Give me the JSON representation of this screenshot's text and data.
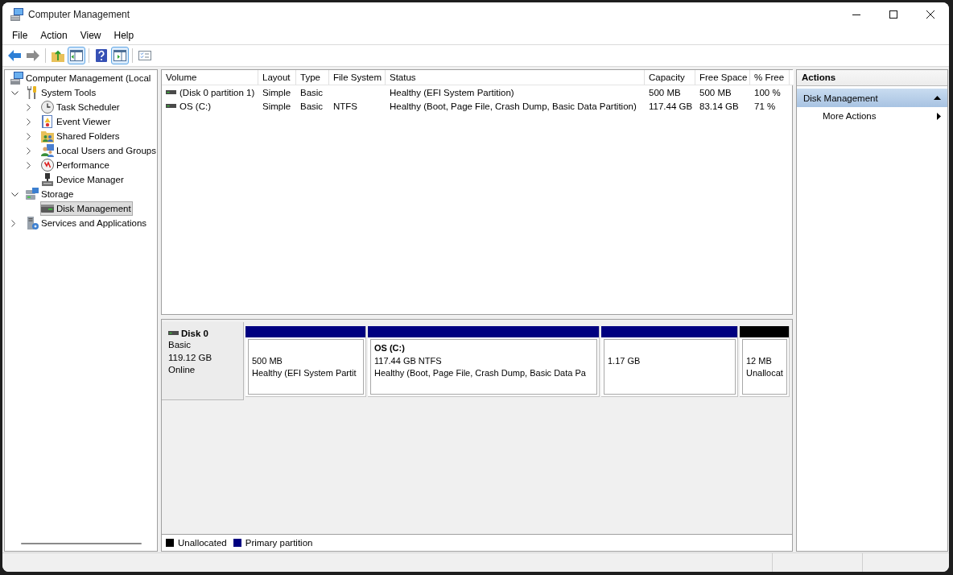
{
  "window": {
    "title": "Computer Management"
  },
  "menu": [
    "File",
    "Action",
    "View",
    "Help"
  ],
  "toolbar": {
    "groups": [
      [
        {
          "pressed": false
        },
        {
          "pressed": false
        }
      ],
      [
        {
          "pressed": false
        },
        {
          "pressed": true
        }
      ],
      [
        {
          "pressed": false
        },
        {
          "pressed": true
        }
      ],
      [
        {
          "pressed": false
        }
      ]
    ]
  },
  "tree": [
    {
      "label": "Computer Management (Local",
      "selected": false,
      "children": [
        {
          "label": "System Tools",
          "expanded": true,
          "selected": false,
          "children": [
            {
              "label": "Task Scheduler",
              "expanded": false,
              "selected": false
            },
            {
              "label": "Event Viewer",
              "expanded": false,
              "selected": false
            },
            {
              "label": "Shared Folders",
              "expanded": false,
              "selected": false
            },
            {
              "label": "Local Users and Groups",
              "expanded": false,
              "selected": false
            },
            {
              "label": "Performance",
              "expanded": false,
              "selected": false
            },
            {
              "label": "Device Manager",
              "selected": false
            }
          ]
        },
        {
          "label": "Storage",
          "expanded": true,
          "selected": false,
          "children": [
            {
              "label": "Disk Management",
              "selected": true
            }
          ]
        },
        {
          "label": "Services and Applications",
          "expanded": false,
          "selected": false
        }
      ]
    }
  ],
  "volumes": {
    "columns": [
      "Volume",
      "Layout",
      "Type",
      "File System",
      "Status",
      "Capacity",
      "Free Space",
      "% Free"
    ],
    "rows": [
      {
        "volume": "(Disk 0 partition 1)",
        "layout": "Simple",
        "type": "Basic",
        "status": "Healthy (EFI System Partition)",
        "capacity": "500 MB",
        "free_space": "500 MB",
        "percent_free": "100 %"
      },
      {
        "volume": "OS (C:)",
        "layout": "Simple",
        "type": "Basic",
        "file_system": "NTFS",
        "status": "Healthy (Boot, Page File, Crash Dump, Basic Data Partition)",
        "capacity": "117.44 GB",
        "free_space": "83.14 GB",
        "percent_free": "71 %"
      }
    ]
  },
  "disks": [
    {
      "name": "Disk 0",
      "type": "Basic",
      "size": "119.12 GB",
      "status": "Online",
      "partitions": [
        {
          "color": "#000080",
          "size": "500 MB",
          "status": "Healthy (EFI System Partit"
        },
        {
          "color": "#000080",
          "name": "OS (C:)",
          "size": "117.44 GB NTFS",
          "status": "Healthy (Boot, Page File, Crash Dump, Basic Data Pa"
        },
        {
          "color": "#000080",
          "size": "1.17 GB"
        },
        {
          "color": "#000000",
          "size": "12 MB",
          "status": "Unallocat"
        }
      ]
    }
  ],
  "legend": [
    {
      "label": "Unallocated",
      "color": "#000000"
    },
    {
      "label": "Primary partition",
      "color": "#000080"
    }
  ],
  "actions": {
    "title": "Actions",
    "sections": [
      {
        "label": "Disk Management",
        "expanded": true,
        "items": [
          {
            "label": "More Actions"
          }
        ]
      }
    ]
  }
}
